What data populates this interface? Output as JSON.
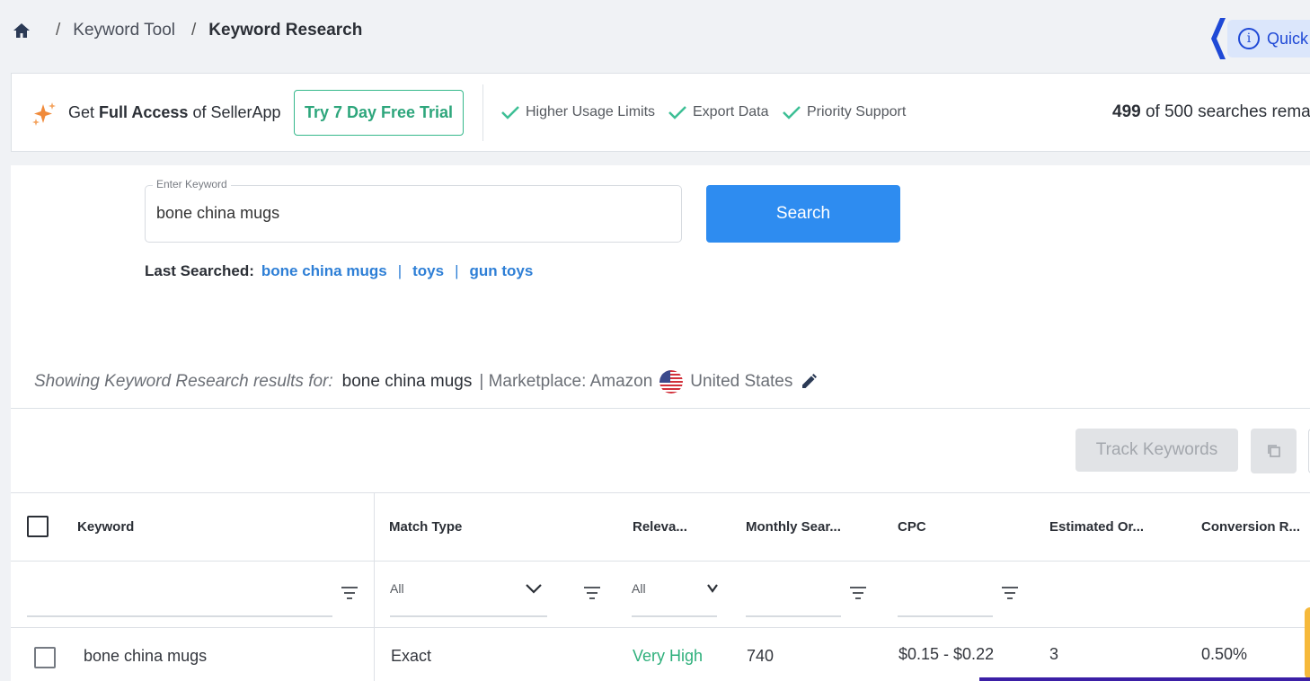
{
  "breadcrumb": {
    "items": [
      "Keyword Tool",
      "Keyword Research"
    ]
  },
  "quick": {
    "label": "Quick"
  },
  "promo": {
    "get_prefix": "Get",
    "get_bold": "Full Access",
    "get_suffix": "of SellerApp",
    "trial_button": "Try 7 Day Free Trial",
    "features": [
      "Higher Usage Limits",
      "Export Data",
      "Priority Support"
    ],
    "searches_used": "499",
    "searches_text": "of 500 searches rema"
  },
  "search": {
    "legend": "Enter Keyword",
    "value": "bone china mugs",
    "button": "Search",
    "last_label": "Last Searched:",
    "recent": [
      "bone china mugs",
      "toys",
      "gun toys"
    ]
  },
  "results": {
    "showing_prefix": "Showing Keyword Research results for:",
    "keyword": "bone china mugs",
    "marketplace": "| Marketplace: Amazon",
    "country": "United States",
    "track_button": "Track Keywords"
  },
  "table": {
    "columns": [
      "Keyword",
      "Match Type",
      "Releva...",
      "Monthly Sear...",
      "CPC",
      "Estimated Or...",
      "Conversion R..."
    ],
    "filters": {
      "match_type": "All",
      "relevance": "All"
    },
    "rows": [
      {
        "keyword": "bone china mugs",
        "match_type": "Exact",
        "relevance": "Very High",
        "monthly_searches": "740",
        "cpc": "$0.15 - $0.22",
        "estimated_orders": "3",
        "conversion_rate": "0.50%"
      }
    ]
  },
  "colors": {
    "accent_blue": "#2e8cf0",
    "trial_green": "#2ea67c",
    "relevance_green": "#2fb07c"
  }
}
